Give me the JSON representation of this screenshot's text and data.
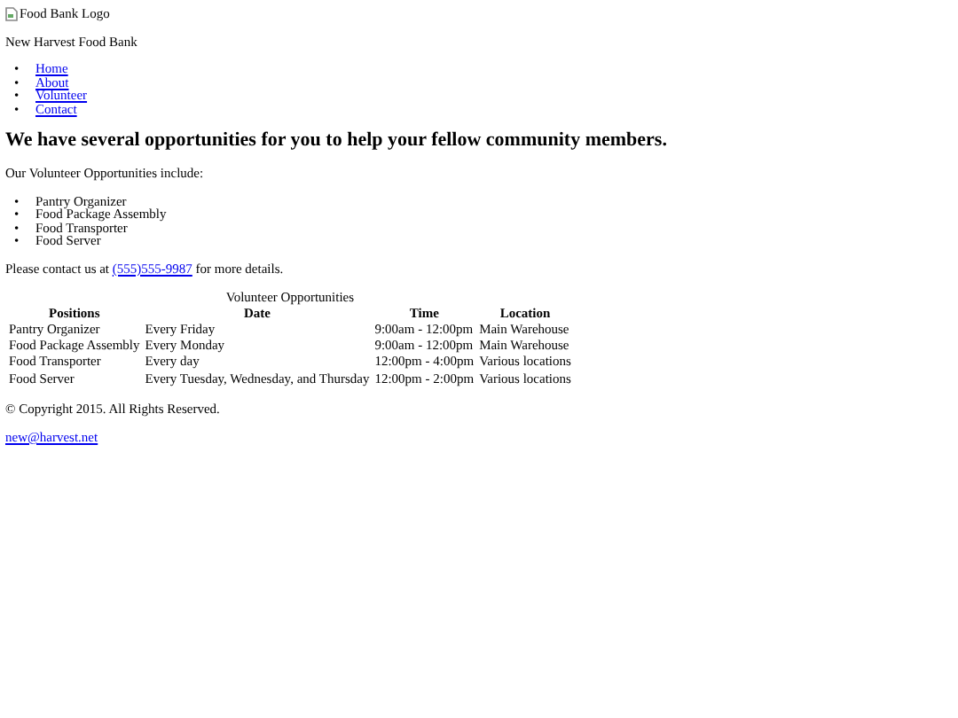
{
  "logo": {
    "alt": "Food Bank Logo"
  },
  "site_name": "New Harvest Food Bank",
  "bullet": "•",
  "nav": [
    {
      "label": "Home"
    },
    {
      "label": "About"
    },
    {
      "label": "Volunteer"
    },
    {
      "label": "Contact"
    }
  ],
  "heading": "We have several opportunities for you to help your fellow community members.",
  "intro": "Our Volunteer Opportunities include:",
  "opportunities": [
    "Pantry Organizer",
    "Food Package Assembly",
    "Food Transporter",
    "Food Server"
  ],
  "contact": {
    "before": "Please contact us at",
    "phone": "(555)555-9987",
    "after": "for more details."
  },
  "table": {
    "caption": "Volunteer Opportunities",
    "columns": [
      "Positions",
      "Date",
      "Time",
      "Location"
    ],
    "rows": [
      [
        "Pantry Organizer",
        "Every Friday",
        "9:00am - 12:00pm",
        "Main Warehouse"
      ],
      [
        "Food Package Assembly",
        "Every Monday",
        "9:00am - 12:00pm",
        "Main Warehouse"
      ],
      [
        "Food Transporter",
        "Every day",
        "12:00pm - 4:00pm",
        "Various locations"
      ],
      [
        "Food Server",
        "Every Tuesday, Wednesday, and Thursday",
        "12:00pm - 2:00pm",
        "Various locations"
      ]
    ]
  },
  "copyright": "© Copyright 2015. All Rights Reserved.",
  "email": "new@harvest.net"
}
